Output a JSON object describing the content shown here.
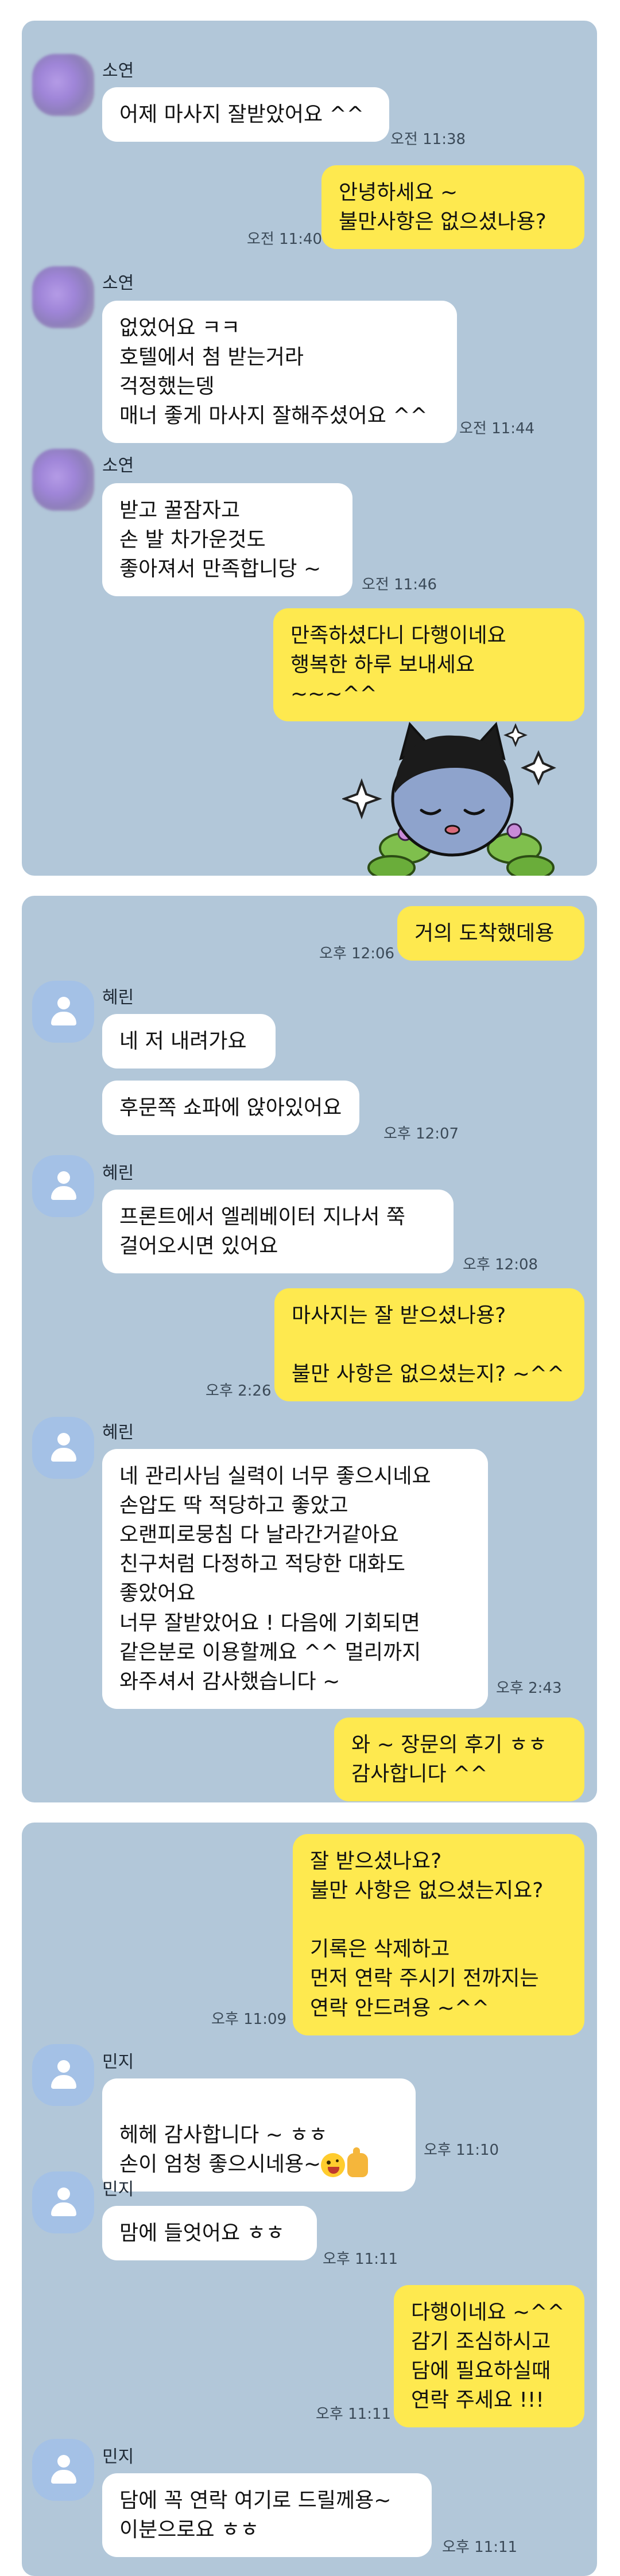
{
  "chat1": {
    "messages": [
      {
        "sender": "소연",
        "text": "어제 마사지 잘받았어요 ^^",
        "time": "오전 11:38"
      },
      {
        "text": "안녕하세요 ~\n불만사항은 없으셨나용?",
        "time": "오전 11:40"
      },
      {
        "sender": "소연",
        "text": "없었어요 ㅋㅋ\n호텔에서 첨 받는거라\n걱정했는뎅\n매너 좋게 마사지 잘해주셨어요 ^^",
        "time": "오전 11:44"
      },
      {
        "sender": "소연",
        "text": "받고 꿀잠자고\n손 발 차가운것도\n좋아져서 만족합니당 ~",
        "time": "오전 11:46"
      },
      {
        "text": "만족하셨다니 다행이네요\n행복한 하루 보내세요 ~~~^^"
      }
    ],
    "sticker": "kakao-friend-sticker"
  },
  "chat2": {
    "messages": [
      {
        "text": "거의 도착했데용",
        "time": "오후 12:06"
      },
      {
        "sender": "혜린",
        "text": "네 저 내려가요"
      },
      {
        "text": "후문쪽 쇼파에 앉아있어요",
        "time": "오후 12:07"
      },
      {
        "sender": "혜린",
        "text": "프론트에서 엘레베이터 지나서 쭉\n걸어오시면 있어요",
        "time": "오후 12:08"
      },
      {
        "text": "마사지는 잘 받으셨나용?\n\n불만 사항은 없으셨는지? ~^^",
        "time": "오후 2:26"
      },
      {
        "sender": "혜린",
        "text": "네 관리사님 실력이 너무 좋으시네요\n손압도 딱 적당하고 좋았고\n오랜피로뭉침 다 날라간거같아요\n친구처럼 다정하고 적당한 대화도\n좋았어요\n너무 잘받았어요 ! 다음에 기회되면\n같은분로 이용할께요 ^^ 멀리까지\n와주셔서 감사했습니다 ~",
        "time": "오후 2:43"
      },
      {
        "text": "와 ~ 장문의 후기 ㅎㅎ\n감사합니다 ^^"
      }
    ]
  },
  "chat3": {
    "messages": [
      {
        "text": "잘 받으셨나요?\n불만 사항은 없으셨는지요?\n\n기록은 삭제하고\n먼저 연락 주시기 전까지는\n연락 안드려용 ~^^",
        "time": "오후 11:09"
      },
      {
        "sender": "민지",
        "text": "헤헤 감사합니다 ~ ㅎㅎ\n손이 엄청 좋으시네용~",
        "time": "오후 11:10"
      },
      {
        "sender": "민지",
        "text": "맘에 들엇어요 ㅎㅎ",
        "time": "오후 11:11"
      },
      {
        "text": "다행이네요 ~^^\n감기 조심하시고\n담에 필요하실때\n연락 주세요 !!!",
        "time": "오후 11:11"
      },
      {
        "sender": "민지",
        "text": "담에 꼭 연락 여기로 드릴께용~\n이분으로요 ㅎㅎ",
        "time": "오후 11:11"
      }
    ]
  },
  "colors": {
    "chat_background": "#b2c7d9",
    "outgoing_bubble": "#fee94f",
    "incoming_bubble": "#ffffff"
  }
}
